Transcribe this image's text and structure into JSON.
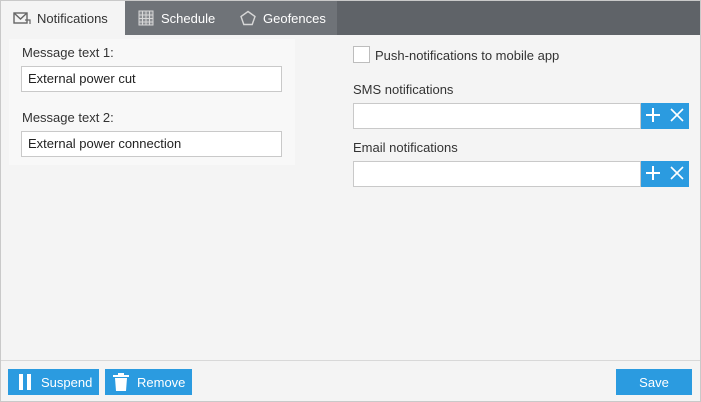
{
  "tabs": [
    {
      "label": "Notifications",
      "icon": "envelope-icon",
      "active": true
    },
    {
      "label": "Schedule",
      "icon": "calendar-grid-icon",
      "active": false
    },
    {
      "label": "Geofences",
      "icon": "pentagon-icon",
      "active": false
    }
  ],
  "messages": {
    "msg1_label": "Message text 1:",
    "msg1_value": "External power cut",
    "msg2_label": "Message text 2:",
    "msg2_value": "External power connection"
  },
  "push": {
    "label": "Push-notifications to mobile app",
    "checked": false
  },
  "sms": {
    "label": "SMS notifications",
    "value": ""
  },
  "email": {
    "label": "Email notifications",
    "value": ""
  },
  "footer": {
    "suspend_label": "Suspend",
    "remove_label": "Remove",
    "save_label": "Save"
  },
  "colors": {
    "accent": "#2b9be0",
    "tabbar": "#5f6368",
    "panel": "#f4f4f4"
  }
}
